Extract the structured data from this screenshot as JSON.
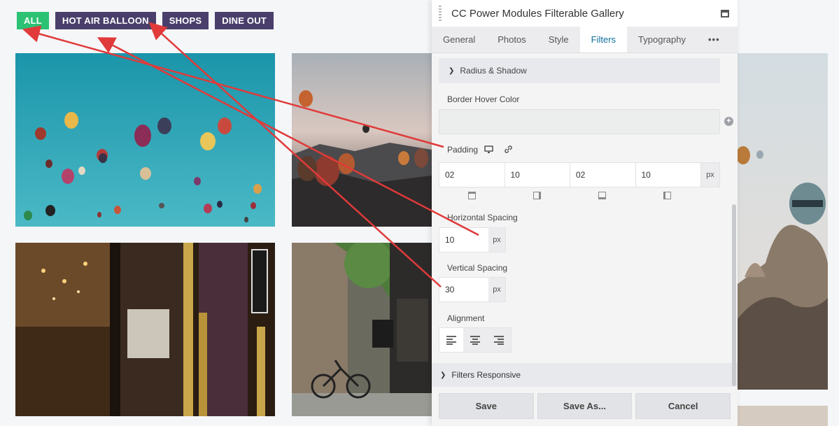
{
  "filters": {
    "all": "ALL",
    "hot_air_balloon": "HOT AIR BALLOON",
    "shops": "SHOPS",
    "dine_out": "DINE OUT",
    "active_color": "#2bc274",
    "inactive_color": "#4a3f6b"
  },
  "panel": {
    "title": "CC Power Modules Filterable Gallery",
    "tabs": [
      "General",
      "Photos",
      "Style",
      "Filters",
      "Typography",
      "•••"
    ],
    "active_tab": "Filters",
    "radius_shadow": "Radius & Shadow",
    "border_hover_color_label": "Border Hover Color",
    "padding_label": "Padding",
    "padding": {
      "top": "02",
      "right": "10",
      "bottom": "02",
      "left": "10",
      "unit": "px"
    },
    "horizontal_spacing_label": "Horizontal Spacing",
    "horizontal_spacing": {
      "value": "10",
      "unit": "px"
    },
    "vertical_spacing_label": "Vertical Spacing",
    "vertical_spacing": {
      "value": "30",
      "unit": "px"
    },
    "alignment_label": "Alignment",
    "filters_responsive": "Filters Responsive",
    "buttons": {
      "save": "Save",
      "save_as": "Save As...",
      "cancel": "Cancel"
    }
  },
  "icons": [
    "grip-icon",
    "minimize-icon",
    "chevron-right-icon",
    "add-color-icon",
    "monitor-icon",
    "link-icon",
    "align-left-icon",
    "align-center-icon",
    "align-right-icon"
  ],
  "colors": {
    "accent_blue": "#0e6e9c",
    "arrow_red": "#e03a3a"
  }
}
